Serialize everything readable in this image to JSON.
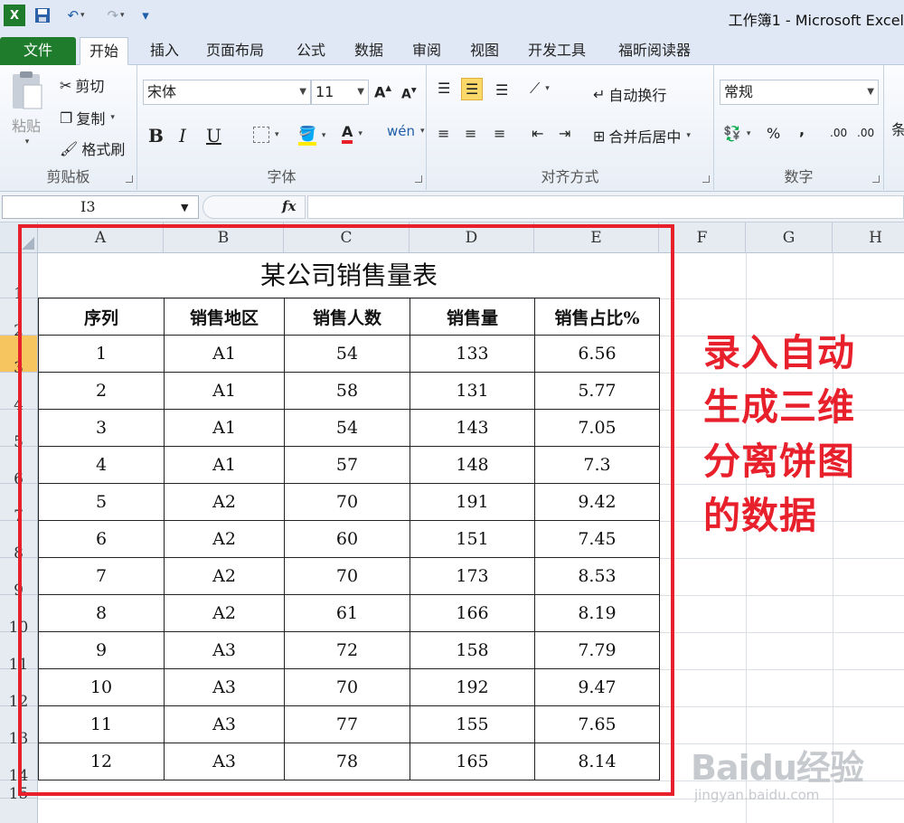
{
  "app": {
    "title": "工作簿1 - Microsoft Excel",
    "icons": [
      "excel-icon",
      "save-icon",
      "undo-icon",
      "redo-icon",
      "customize-icon"
    ]
  },
  "tabs": [
    {
      "label": "文件"
    },
    {
      "label": "开始"
    },
    {
      "label": "插入"
    },
    {
      "label": "页面布局"
    },
    {
      "label": "公式"
    },
    {
      "label": "数据"
    },
    {
      "label": "审阅"
    },
    {
      "label": "视图"
    },
    {
      "label": "开发工具"
    },
    {
      "label": "福昕阅读器"
    }
  ],
  "ribbon": {
    "clipboard": {
      "label": "剪贴板",
      "paste": "粘贴",
      "cut": "剪切",
      "copy": "复制",
      "format_painter": "格式刷"
    },
    "font": {
      "label": "字体",
      "name": "宋体",
      "size": "11",
      "bold": "B",
      "italic": "I",
      "underline": "U"
    },
    "alignment": {
      "label": "对齐方式",
      "wrap": "自动换行",
      "merge": "合并后居中"
    },
    "number": {
      "label": "数字",
      "format": "常规",
      "percent": "%",
      "comma": ","
    },
    "styles": {
      "partial": "条"
    }
  },
  "formula_bar": {
    "cell_ref": "I3",
    "fx": "fx",
    "value": ""
  },
  "columns": [
    "A",
    "B",
    "C",
    "D",
    "E",
    "F",
    "G",
    "H"
  ],
  "rows": [
    "1",
    "2",
    "3",
    "4",
    "5",
    "6",
    "7",
    "8",
    "9",
    "10",
    "11",
    "12",
    "13",
    "14",
    "15",
    "16"
  ],
  "selected_row": "3",
  "sheet": {
    "title": "某公司销售量表",
    "headers": [
      "序列",
      "销售地区",
      "销售人数",
      "销售量",
      "销售占比%"
    ],
    "data": [
      [
        "1",
        "A1",
        "54",
        "133",
        "6.56"
      ],
      [
        "2",
        "A1",
        "58",
        "131",
        "5.77"
      ],
      [
        "3",
        "A1",
        "54",
        "143",
        "7.05"
      ],
      [
        "4",
        "A1",
        "57",
        "148",
        "7.3"
      ],
      [
        "5",
        "A2",
        "70",
        "191",
        "9.42"
      ],
      [
        "6",
        "A2",
        "60",
        "151",
        "7.45"
      ],
      [
        "7",
        "A2",
        "70",
        "173",
        "8.53"
      ],
      [
        "8",
        "A2",
        "61",
        "166",
        "8.19"
      ],
      [
        "9",
        "A3",
        "72",
        "158",
        "7.79"
      ],
      [
        "10",
        "A3",
        "70",
        "192",
        "9.47"
      ],
      [
        "11",
        "A3",
        "77",
        "155",
        "7.65"
      ],
      [
        "12",
        "A3",
        "78",
        "165",
        "8.14"
      ]
    ]
  },
  "annotation": {
    "lines": [
      "录入自动",
      "生成三维",
      "分离饼图",
      "的数据"
    ],
    "color": "#e8202b"
  },
  "watermark": {
    "logo": "Baidu经验",
    "site": "jingyan.baidu.com"
  }
}
